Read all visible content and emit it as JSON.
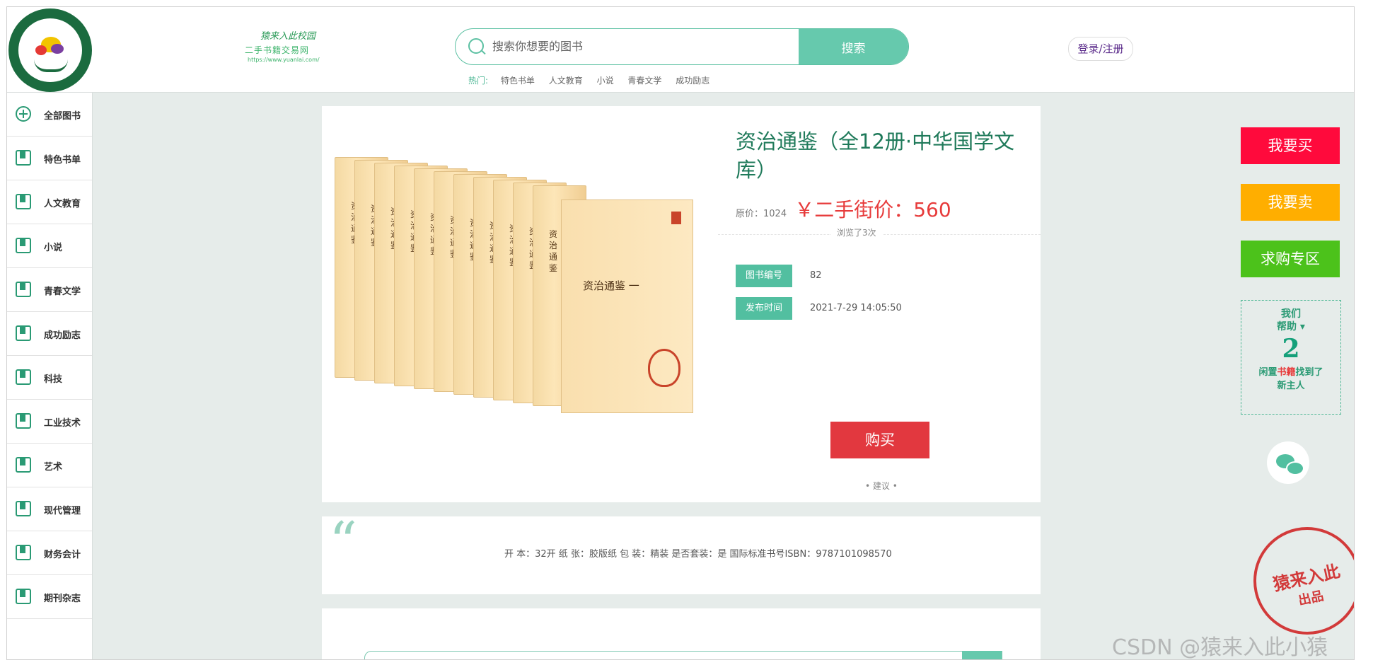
{
  "header": {
    "site_logo_line1": "猿来入此校园",
    "site_logo_line2": "二手书籍交易网",
    "site_logo_line3": "https://www.yuanlai.com/",
    "search_placeholder": "搜索你想要的图书",
    "search_button": "搜索",
    "hot_label": "热门:",
    "hot_links": [
      "特色书单",
      "人文教育",
      "小说",
      "青春文学",
      "成功励志"
    ],
    "login": "登录/注册"
  },
  "sidebar": {
    "items": [
      {
        "label": "全部图书",
        "icon": "plus-circle-icon"
      },
      {
        "label": "特色书单",
        "icon": "book-icon"
      },
      {
        "label": "人文教育",
        "icon": "book-icon"
      },
      {
        "label": "小说",
        "icon": "book-icon"
      },
      {
        "label": "青春文学",
        "icon": "book-icon"
      },
      {
        "label": "成功励志",
        "icon": "book-icon"
      },
      {
        "label": "科技",
        "icon": "book-icon"
      },
      {
        "label": "工业技术",
        "icon": "book-icon"
      },
      {
        "label": "艺术",
        "icon": "book-icon"
      },
      {
        "label": "现代管理",
        "icon": "book-icon"
      },
      {
        "label": "财务会计",
        "icon": "book-icon"
      },
      {
        "label": "期刊杂志",
        "icon": "book-icon"
      }
    ]
  },
  "book": {
    "title": "资治通鉴（全12册·中华国学文库）",
    "original_price_label": "原价：1024",
    "secondhand_price_label": "￥二手街价：560",
    "views": "浏览了3次",
    "id_label": "图书编号",
    "id_value": "82",
    "time_label": "发布时间",
    "time_value": "2021-7-29 14:05:50",
    "buy_button": "购买",
    "suggest": "•   建议   •",
    "cover_title": "资治通鉴 一",
    "spine_title": "资治通鉴"
  },
  "description": {
    "quote": "“",
    "text": "开 本：32开 纸 张：胶版纸 包 装：精装 是否套装：是 国际标准书号ISBN：9787101098570"
  },
  "right": {
    "buy_button": "我要买",
    "sell_button": "我要卖",
    "wanted_button": "求购专区",
    "help_line1": "我们",
    "help_line2": "帮助 ▾",
    "help_number": "2",
    "help_line3_a": "闲置",
    "help_line3_b": "书籍",
    "help_line3_c": "找到了",
    "help_line4": "新主人",
    "stamp_text": "猿来入此",
    "stamp_sub": "出品"
  },
  "watermark": "CSDN @猿来入此小猿",
  "colors": {
    "accent": "#66c9ad",
    "price_red": "#e73b3b",
    "buy_red": "#e2383f",
    "sell_orange": "#ffae00",
    "wanted_green": "#4cc21b",
    "title_green": "#1f7a5a"
  }
}
